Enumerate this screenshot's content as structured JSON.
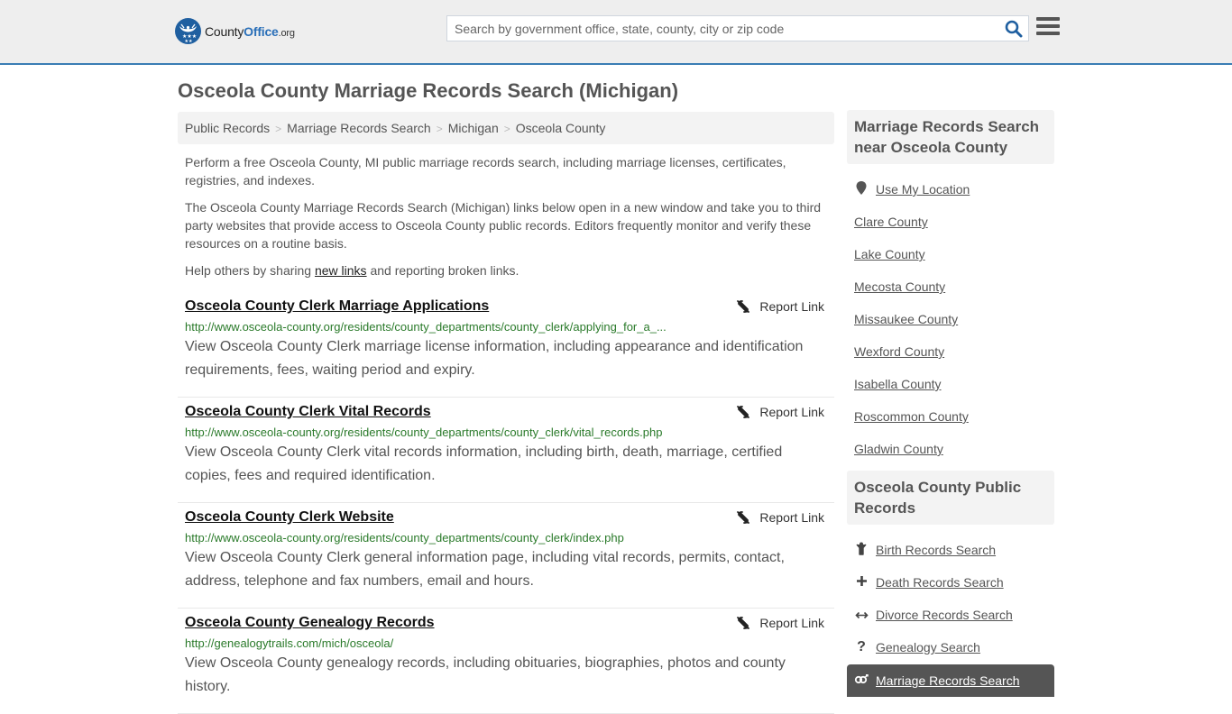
{
  "header": {
    "logo": {
      "name": "County",
      "accent": "Office",
      "tld": ".org"
    },
    "search": {
      "placeholder": "Search by government office, state, county, city or zip code",
      "value": ""
    },
    "colors": {
      "brand": "#1f5fa0",
      "border": "#3a7db4",
      "header_bg": "#eeeeee"
    }
  },
  "page": {
    "title": "Osceola County Marriage Records Search (Michigan)"
  },
  "breadcrumb": [
    {
      "label": "Public Records"
    },
    {
      "label": "Marriage Records Search"
    },
    {
      "label": "Michigan"
    },
    {
      "label": "Osceola County"
    }
  ],
  "breadcrumb_separator": ">",
  "intro": {
    "p1": "Perform a free Osceola County, MI public marriage records search, including marriage licenses, certificates, registries, and indexes.",
    "p2": "The Osceola County Marriage Records Search (Michigan) links below open in a new window and take you to third party websites that provide access to Osceola County public records. Editors frequently monitor and verify these resources on a routine basis.",
    "p3_before": "Help others by sharing ",
    "p3_link": "new links",
    "p3_after": " and reporting broken links."
  },
  "report_label": "Report Link",
  "results": [
    {
      "title": "Osceola County Clerk Marriage Applications",
      "url": "http://www.osceola-county.org/residents/county_departments/county_clerk/applying_for_a_...",
      "description": "View Osceola County Clerk marriage license information, including appearance and identification requirements, fees, waiting period and expiry."
    },
    {
      "title": "Osceola County Clerk Vital Records",
      "url": "http://www.osceola-county.org/residents/county_departments/county_clerk/vital_records.php",
      "description": "View Osceola County Clerk vital records information, including birth, death, marriage, certified copies, fees and required identification."
    },
    {
      "title": "Osceola County Clerk Website",
      "url": "http://www.osceola-county.org/residents/county_departments/county_clerk/index.php",
      "description": "View Osceola County Clerk general information page, including vital records, permits, contact, address, telephone and fax numbers, email and hours."
    },
    {
      "title": "Osceola County Genealogy Records",
      "url": "http://genealogytrails.com/mich/osceola/",
      "description": "View Osceola County genealogy records, including obituaries, biographies, photos and county history."
    }
  ],
  "sidebar": {
    "nearby": {
      "heading": "Marriage Records Search near Osceola County",
      "use_location": "Use My Location",
      "counties": [
        "Clare County",
        "Lake County",
        "Mecosta County",
        "Missaukee County",
        "Wexford County",
        "Isabella County",
        "Roscommon County",
        "Gladwin County"
      ]
    },
    "public_records": {
      "heading": "Osceola County Public Records",
      "items": [
        {
          "label": "Birth Records Search",
          "icon": "child-icon"
        },
        {
          "label": "Death Records Search",
          "icon": "plus-icon"
        },
        {
          "label": "Divorce Records Search",
          "icon": "arrows-h-icon"
        },
        {
          "label": "Genealogy Search",
          "icon": "question-icon"
        }
      ],
      "active": {
        "label": "Marriage Records Search",
        "icon": "venus-mars-icon"
      }
    }
  }
}
